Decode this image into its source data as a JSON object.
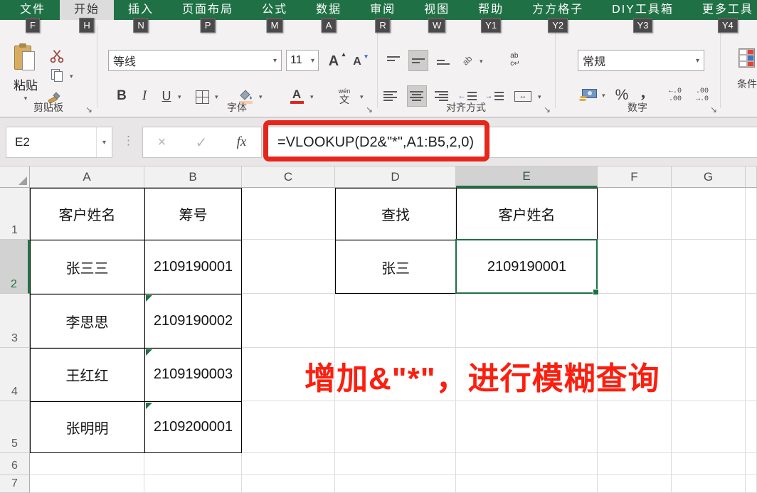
{
  "tab_bar": {
    "tabs": [
      {
        "label": "文件",
        "keytip": "F",
        "selected": false
      },
      {
        "label": "开始",
        "keytip": "H",
        "selected": true
      },
      {
        "label": "插入",
        "keytip": "N",
        "selected": false
      },
      {
        "label": "页面布局",
        "keytip": "P",
        "selected": false
      },
      {
        "label": "公式",
        "keytip": "M",
        "selected": false
      },
      {
        "label": "数据",
        "keytip": "A",
        "selected": false
      },
      {
        "label": "审阅",
        "keytip": "R",
        "selected": false
      },
      {
        "label": "视图",
        "keytip": "W",
        "selected": false
      },
      {
        "label": "帮助",
        "keytip": "Y1",
        "selected": false
      },
      {
        "label": "方方格子",
        "keytip": "Y2",
        "selected": false
      },
      {
        "label": "DIY工具箱",
        "keytip": "Y3",
        "selected": false
      },
      {
        "label": "更多工具",
        "keytip": "Y4",
        "selected": false
      }
    ]
  },
  "ribbon": {
    "clipboard": {
      "group_label": "剪贴板",
      "paste_label": "粘贴"
    },
    "font": {
      "group_label": "字体",
      "font_name": "等线",
      "font_size": "11",
      "bold": "B",
      "italic": "I",
      "underline": "U",
      "grow_font": "A",
      "shrink_font": "A",
      "phonetic_pinyin": "wén",
      "phonetic_char": "文"
    },
    "alignment": {
      "group_label": "对齐方式",
      "orientation_label": "ab",
      "wrap_line1": "ab",
      "wrap_line2": "c↵",
      "merge_arrow": "↔"
    },
    "number": {
      "group_label": "数字",
      "format_value": "常规",
      "percent": "%",
      "comma": ",",
      "inc_decimal_top": "←.0",
      "inc_decimal_bottom": ".00",
      "dec_decimal_top": ".00",
      "dec_decimal_bottom": "→.0"
    },
    "conditional_format": {
      "label": "条件"
    }
  },
  "formula_bar": {
    "name_box": "E2",
    "cancel": "×",
    "enter": "✓",
    "fx": "fx",
    "formula": "=VLOOKUP(D2&\"*\",A1:B5,2,0)"
  },
  "grid": {
    "column_headers": [
      "A",
      "B",
      "C",
      "D",
      "E",
      "F",
      "G"
    ],
    "row_headers": [
      "1",
      "2",
      "3",
      "4",
      "5",
      "6",
      "7"
    ],
    "selected_column": "E",
    "selected_row": "2",
    "selected_cell": "E2",
    "cells": {
      "A1": "客户姓名",
      "B1": "筹号",
      "D1": "查找",
      "E1": "客户姓名",
      "A2": "张三三",
      "B2": "2109190001",
      "D2": "张三",
      "E2": "2109190001",
      "A3": "李思思",
      "B3": "2109190002",
      "A4": "王红红",
      "B4": "2109190003",
      "A5": "张明明",
      "B5": "2109200001"
    }
  },
  "annotation": "增加&\"*\"，进行模糊查询",
  "icons": {
    "dropdown": "▾",
    "up_triangle": "▴",
    "down_triangle": "▾",
    "dots": "⋮",
    "launcher": "↘"
  },
  "colors": {
    "excel_green": "#1f7145",
    "selection_green": "#1e7145",
    "highlight_red": "#e6261b",
    "annotation_red": "#fc1e0e"
  }
}
